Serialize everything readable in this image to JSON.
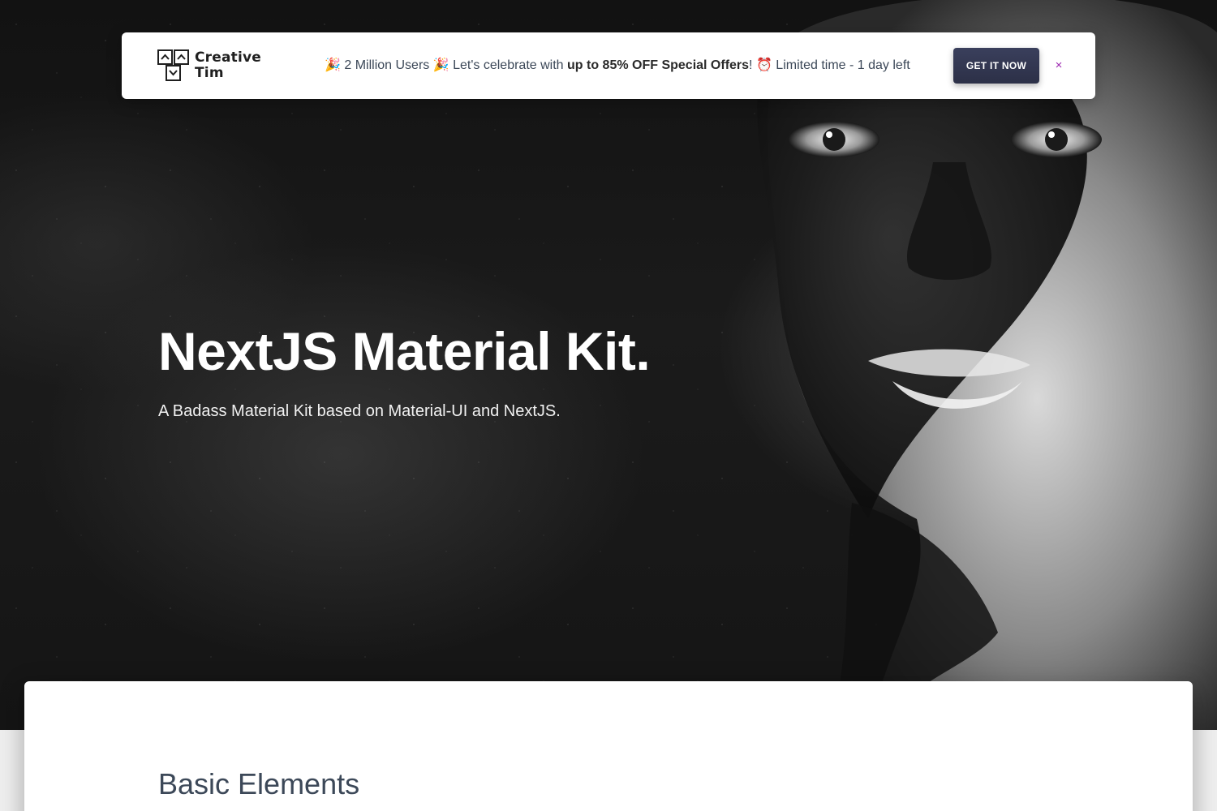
{
  "promo_bar": {
    "brand": {
      "line1": "Creative",
      "line2": "Tim",
      "icon": "creative-tim-logo"
    },
    "message_part1": "🎉 2 Million Users 🎉 Let's celebrate with ",
    "message_bold": "up to 85% OFF Special Offers",
    "message_part2": "! ⏰ Limited time - 1 day left",
    "cta_label": "GET IT NOW",
    "close_label": "×",
    "close_icon": "close-icon"
  },
  "hero": {
    "title": "NextJS Material Kit.",
    "subtitle": "A Badass Material Kit based on Material-UI and NextJS."
  },
  "main": {
    "section_title": "Basic Elements"
  },
  "colors": {
    "cta_background": "#2c3047",
    "close_accent": "#9c27b0",
    "heading_text": "#3c4858"
  }
}
